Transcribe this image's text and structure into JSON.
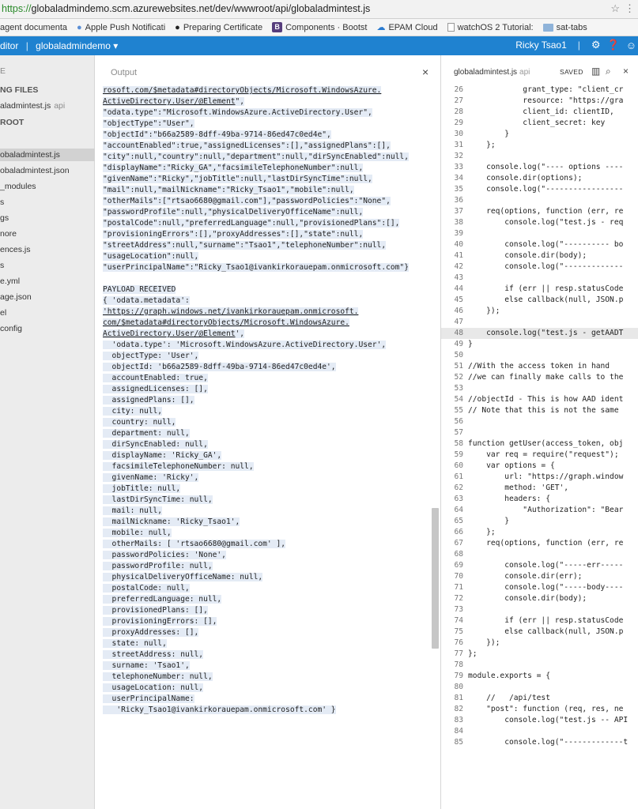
{
  "browser": {
    "url_scheme": "https://",
    "url_rest": "globaladmindemo.scm.azurewebsites.net/dev/wwwroot/api/globaladmintest.js",
    "bookmarks": [
      {
        "label": "agent documenta",
        "icon": "none"
      },
      {
        "label": "Apple Push Notificati",
        "icon": "apple-icon"
      },
      {
        "label": "Preparing Certificate",
        "icon": "github-icon"
      },
      {
        "label": "Components · Bootst",
        "icon": "bootstrap-icon"
      },
      {
        "label": "EPAM Cloud",
        "icon": "cloud-icon"
      },
      {
        "label": "watchOS 2 Tutorial:",
        "icon": "page-icon"
      },
      {
        "label": "sat-tabs",
        "icon": "folder-icon"
      }
    ]
  },
  "header": {
    "app": "ditor",
    "site": "globaladmindemo",
    "user": "Ricky Tsao1",
    "caret": "▾"
  },
  "sidebar": {
    "items": [
      {
        "label": "E",
        "style": "dim"
      },
      {
        "label": "NG FILES",
        "style": "head"
      },
      {
        "label": "aladmintest.js",
        "suffix": "api",
        "style": "normal"
      },
      {
        "label": "ROOT",
        "style": "head"
      },
      {
        "label": "obaladmintest.js",
        "style": "active"
      },
      {
        "label": "obaladmintest.json",
        "style": "normal"
      },
      {
        "label": "_modules",
        "style": "normal"
      },
      {
        "label": "s",
        "style": "normal"
      },
      {
        "label": "gs",
        "style": "normal"
      },
      {
        "label": "nore",
        "style": "normal"
      },
      {
        "label": "ences.js",
        "style": "normal"
      },
      {
        "label": "s",
        "style": "normal"
      },
      {
        "label": "e.yml",
        "style": "normal"
      },
      {
        "label": "age.json",
        "style": "normal"
      },
      {
        "label": "el",
        "style": "normal"
      },
      {
        "label": "config",
        "style": "normal"
      }
    ]
  },
  "output": {
    "title": "Output",
    "close": "×",
    "lines": [
      {
        "t": "rosoft.com/$metadata#directoryObjects/Microsoft.WindowsAzure.",
        "link": true
      },
      {
        "t": "ActiveDirectory.User/@Element",
        "link": true,
        "after": "\","
      },
      {
        "t": "\"odata.type\":\"Microsoft.WindowsAzure.ActiveDirectory.User\","
      },
      {
        "t": "\"objectType\":\"User\","
      },
      {
        "t": "\"objectId\":\"b66a2589-8dff-49ba-9714-86ed47c0ed4e\","
      },
      {
        "t": "\"accountEnabled\":true,\"assignedLicenses\":[],\"assignedPlans\":[],"
      },
      {
        "t": "\"city\":null,\"country\":null,\"department\":null,\"dirSyncEnabled\":null,"
      },
      {
        "t": "\"displayName\":\"Ricky_GA\",\"facsimileTelephoneNumber\":null,"
      },
      {
        "t": "\"givenName\":\"Ricky\",\"jobTitle\":null,\"lastDirSyncTime\":null,"
      },
      {
        "t": "\"mail\":null,\"mailNickname\":\"Ricky_Tsao1\",\"mobile\":null,"
      },
      {
        "t": "\"otherMails\":[\"rtsao6680@gmail.com\"],\"passwordPolicies\":\"None\","
      },
      {
        "t": "\"passwordProfile\":null,\"physicalDeliveryOfficeName\":null,"
      },
      {
        "t": "\"postalCode\":null,\"preferredLanguage\":null,\"provisionedPlans\":[],"
      },
      {
        "t": "\"provisioningErrors\":[],\"proxyAddresses\":[],\"state\":null,"
      },
      {
        "t": "\"streetAddress\":null,\"surname\":\"Tsao1\",\"telephoneNumber\":null,"
      },
      {
        "t": "\"usageLocation\":null,"
      },
      {
        "t": "\"userPrincipalName\":\"Ricky_Tsao1@ivankirkorauepam.onmicrosoft.com\"}"
      },
      {
        "t": ""
      },
      {
        "t": "PAYLOAD RECEIVED"
      },
      {
        "t": "{ 'odata.metadata':"
      },
      {
        "t": "'https://graph.windows.net/ivankirkorauepam.onmicrosoft.",
        "link": true
      },
      {
        "t": "com/$metadata#directoryObjects/Microsoft.WindowsAzure.",
        "link": true
      },
      {
        "t": "ActiveDirectory.User/@Element",
        "link": true,
        "after": "',"
      },
      {
        "t": "  'odata.type': 'Microsoft.WindowsAzure.ActiveDirectory.User',"
      },
      {
        "t": "  objectType: 'User',"
      },
      {
        "t": "  objectId: 'b66a2589-8dff-49ba-9714-86ed47c0ed4e',"
      },
      {
        "t": "  accountEnabled: true,"
      },
      {
        "t": "  assignedLicenses: [],"
      },
      {
        "t": "  assignedPlans: [],"
      },
      {
        "t": "  city: null,"
      },
      {
        "t": "  country: null,"
      },
      {
        "t": "  department: null,"
      },
      {
        "t": "  dirSyncEnabled: null,"
      },
      {
        "t": "  displayName: 'Ricky_GA',"
      },
      {
        "t": "  facsimileTelephoneNumber: null,"
      },
      {
        "t": "  givenName: 'Ricky',"
      },
      {
        "t": "  jobTitle: null,"
      },
      {
        "t": "  lastDirSyncTime: null,"
      },
      {
        "t": "  mail: null,"
      },
      {
        "t": "  mailNickname: 'Ricky_Tsao1',"
      },
      {
        "t": "  mobile: null,"
      },
      {
        "t": "  otherMails: [ 'rtsao6680@gmail.com' ],"
      },
      {
        "t": "  passwordPolicies: 'None',"
      },
      {
        "t": "  passwordProfile: null,"
      },
      {
        "t": "  physicalDeliveryOfficeName: null,"
      },
      {
        "t": "  postalCode: null,"
      },
      {
        "t": "  preferredLanguage: null,"
      },
      {
        "t": "  provisionedPlans: [],"
      },
      {
        "t": "  provisioningErrors: [],"
      },
      {
        "t": "  proxyAddresses: [],"
      },
      {
        "t": "  state: null,"
      },
      {
        "t": "  streetAddress: null,"
      },
      {
        "t": "  surname: 'Tsao1',"
      },
      {
        "t": "  telephoneNumber: null,"
      },
      {
        "t": "  usageLocation: null,"
      },
      {
        "t": "  userPrincipalName:"
      },
      {
        "t": "   'Ricky_Tsao1@ivankirkorauepam.onmicrosoft.com' }"
      }
    ]
  },
  "editor": {
    "filename": "globaladmintest.js",
    "api_tag": "api",
    "saved": "SAVED",
    "highlight_line": 48,
    "lines": [
      {
        "n": 26,
        "t": "            grant_type: \"client_cr"
      },
      {
        "n": 27,
        "t": "            resource: \"https://gra"
      },
      {
        "n": 28,
        "t": "            client_id: clientID,"
      },
      {
        "n": 29,
        "t": "            client_secret: key"
      },
      {
        "n": 30,
        "t": "        }"
      },
      {
        "n": 31,
        "t": "    };"
      },
      {
        "n": 32,
        "t": ""
      },
      {
        "n": 33,
        "t": "    console.log(\"---- options ----"
      },
      {
        "n": 34,
        "t": "    console.dir(options);"
      },
      {
        "n": 35,
        "t": "    console.log(\"-----------------"
      },
      {
        "n": 36,
        "t": ""
      },
      {
        "n": 37,
        "t": "    req(options, function (err, re"
      },
      {
        "n": 38,
        "t": "        console.log(\"test.js - req"
      },
      {
        "n": 39,
        "t": ""
      },
      {
        "n": 40,
        "t": "        console.log(\"---------- bo"
      },
      {
        "n": 41,
        "t": "        console.dir(body);"
      },
      {
        "n": 42,
        "t": "        console.log(\"-------------"
      },
      {
        "n": 43,
        "t": ""
      },
      {
        "n": 44,
        "t": "        if (err || resp.statusCode"
      },
      {
        "n": 45,
        "t": "        else callback(null, JSON.p"
      },
      {
        "n": 46,
        "t": "    });"
      },
      {
        "n": 47,
        "t": ""
      },
      {
        "n": 48,
        "t": "    console.log(\"test.js - getAADT"
      },
      {
        "n": 49,
        "t": "}"
      },
      {
        "n": 50,
        "t": ""
      },
      {
        "n": 51,
        "t": "//With the access token in hand"
      },
      {
        "n": 52,
        "t": "//we can finally make calls to the"
      },
      {
        "n": 53,
        "t": ""
      },
      {
        "n": 54,
        "t": "//objectId - This is how AAD ident"
      },
      {
        "n": 55,
        "t": "// Note that this is not the same"
      },
      {
        "n": 56,
        "t": ""
      },
      {
        "n": 57,
        "t": ""
      },
      {
        "n": 58,
        "t": "function getUser(access_token, obj"
      },
      {
        "n": 59,
        "t": "    var req = require(\"request\");"
      },
      {
        "n": 60,
        "t": "    var options = {"
      },
      {
        "n": 61,
        "t": "        url: \"https://graph.window"
      },
      {
        "n": 62,
        "t": "        method: 'GET',"
      },
      {
        "n": 63,
        "t": "        headers: {"
      },
      {
        "n": 64,
        "t": "            \"Authorization\": \"Bear"
      },
      {
        "n": 65,
        "t": "        }"
      },
      {
        "n": 66,
        "t": "    };"
      },
      {
        "n": 67,
        "t": "    req(options, function (err, re"
      },
      {
        "n": 68,
        "t": ""
      },
      {
        "n": 69,
        "t": "        console.log(\"-----err-----"
      },
      {
        "n": 70,
        "t": "        console.dir(err);"
      },
      {
        "n": 71,
        "t": "        console.log(\"-----body----"
      },
      {
        "n": 72,
        "t": "        console.dir(body);"
      },
      {
        "n": 73,
        "t": ""
      },
      {
        "n": 74,
        "t": "        if (err || resp.statusCode"
      },
      {
        "n": 75,
        "t": "        else callback(null, JSON.p"
      },
      {
        "n": 76,
        "t": "    });"
      },
      {
        "n": 77,
        "t": "};"
      },
      {
        "n": 78,
        "t": ""
      },
      {
        "n": 79,
        "t": "module.exports = {"
      },
      {
        "n": 80,
        "t": ""
      },
      {
        "n": 81,
        "t": "    //   /api/test"
      },
      {
        "n": 82,
        "t": "    \"post\": function (req, res, ne"
      },
      {
        "n": 83,
        "t": "        console.log(\"test.js -- API"
      },
      {
        "n": 84,
        "t": ""
      },
      {
        "n": 85,
        "t": "        console.log(\"-------------t"
      }
    ]
  }
}
